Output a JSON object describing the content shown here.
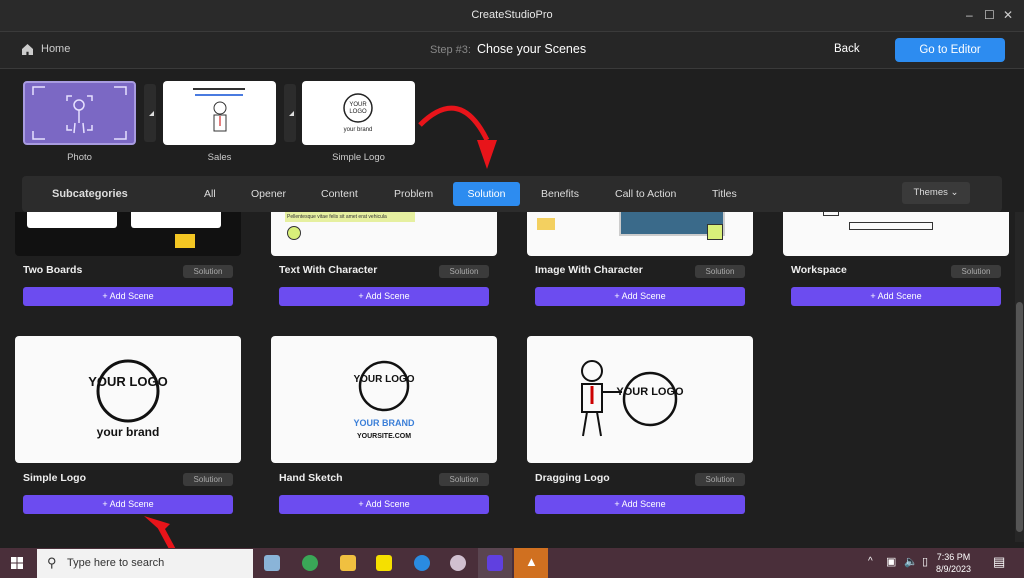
{
  "window": {
    "title": "CreateStudioPro",
    "minimize": "–",
    "maximize": "☐",
    "close": "✕"
  },
  "header": {
    "home_label": "Home",
    "step_prefix": "Step #3:",
    "step_title": "Chose your Scenes",
    "back_label": "Back",
    "editor_label": "Go to Editor"
  },
  "selected_scenes": [
    {
      "label": "Photo"
    },
    {
      "label": "Sales"
    },
    {
      "label": "Simple Logo"
    }
  ],
  "subcategories": {
    "label": "Subcategories",
    "tabs": [
      "All",
      "Opener",
      "Content",
      "Problem",
      "Solution",
      "Benefits",
      "Call to Action",
      "Titles"
    ],
    "active": "Solution",
    "themes_label": "Themes"
  },
  "scenes": [
    {
      "name": "Two Boards",
      "badge": "Solution",
      "add": "+ Add Scene"
    },
    {
      "name": "Text With Character",
      "badge": "Solution",
      "add": "+ Add Scene",
      "thumb_text": "Pellentesque vitae felis sit amet erat vehicula"
    },
    {
      "name": "Image With Character",
      "badge": "Solution",
      "add": "+ Add Scene"
    },
    {
      "name": "Workspace",
      "badge": "Solution",
      "add": "+ Add Scene"
    },
    {
      "name": "Simple Logo",
      "badge": "Solution",
      "add": "+ Add Scene",
      "logo": "YOUR LOGO",
      "brand": "your brand"
    },
    {
      "name": "Hand Sketch",
      "badge": "Solution",
      "add": "+ Add Scene",
      "logo": "YOUR LOGO",
      "brand": "YOUR BRAND",
      "site": "YOURSITE.COM"
    },
    {
      "name": "Dragging Logo",
      "badge": "Solution",
      "add": "+ Add Scene",
      "logo": "YOUR LOGO"
    }
  ],
  "taskbar": {
    "search_placeholder": "Type here to search",
    "time": "7:36 PM",
    "date": "8/9/2023"
  },
  "colors": {
    "accent": "#2d8cf0",
    "add_button": "#6c4cf0",
    "annotation_arrow": "#e8141a"
  }
}
